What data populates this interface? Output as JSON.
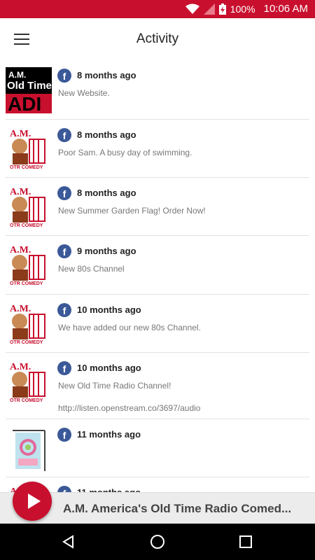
{
  "status": {
    "battery": "100%",
    "time": "10:06 AM"
  },
  "appbar": {
    "title": "Activity"
  },
  "feed": {
    "items": [
      {
        "time": "8 months ago",
        "message": "New Website.",
        "link": "",
        "thumb": "old-time-radio-logo"
      },
      {
        "time": "8 months ago",
        "message": "Poor Sam. A busy day of  swimming.",
        "link": "",
        "thumb": "otr-comedy-logo"
      },
      {
        "time": "8 months ago",
        "message": "New Summer Garden Flag! Order Now!",
        "link": "",
        "thumb": "otr-comedy-logo"
      },
      {
        "time": "9 months ago",
        "message": "New 80s Channel",
        "link": "",
        "thumb": "otr-comedy-logo"
      },
      {
        "time": "10 months ago",
        "message": "We have added our new 80s Channel.",
        "link": "",
        "thumb": "otr-comedy-logo"
      },
      {
        "time": "10 months ago",
        "message": "New Old Time Radio Channel!",
        "link": "http://listen.openstream.co/3697/audio",
        "thumb": "otr-comedy-logo"
      },
      {
        "time": "11 months ago",
        "message": "",
        "link": "",
        "thumb": "garden-flag-image"
      },
      {
        "time": "11 months ago",
        "message": "",
        "link": "",
        "thumb": "otr-comedy-logo"
      }
    ]
  },
  "player": {
    "now_playing": "A.M. America's Old Time Radio Comed..."
  },
  "colors": {
    "accent": "#c8102e",
    "facebook": "#3b5998"
  }
}
